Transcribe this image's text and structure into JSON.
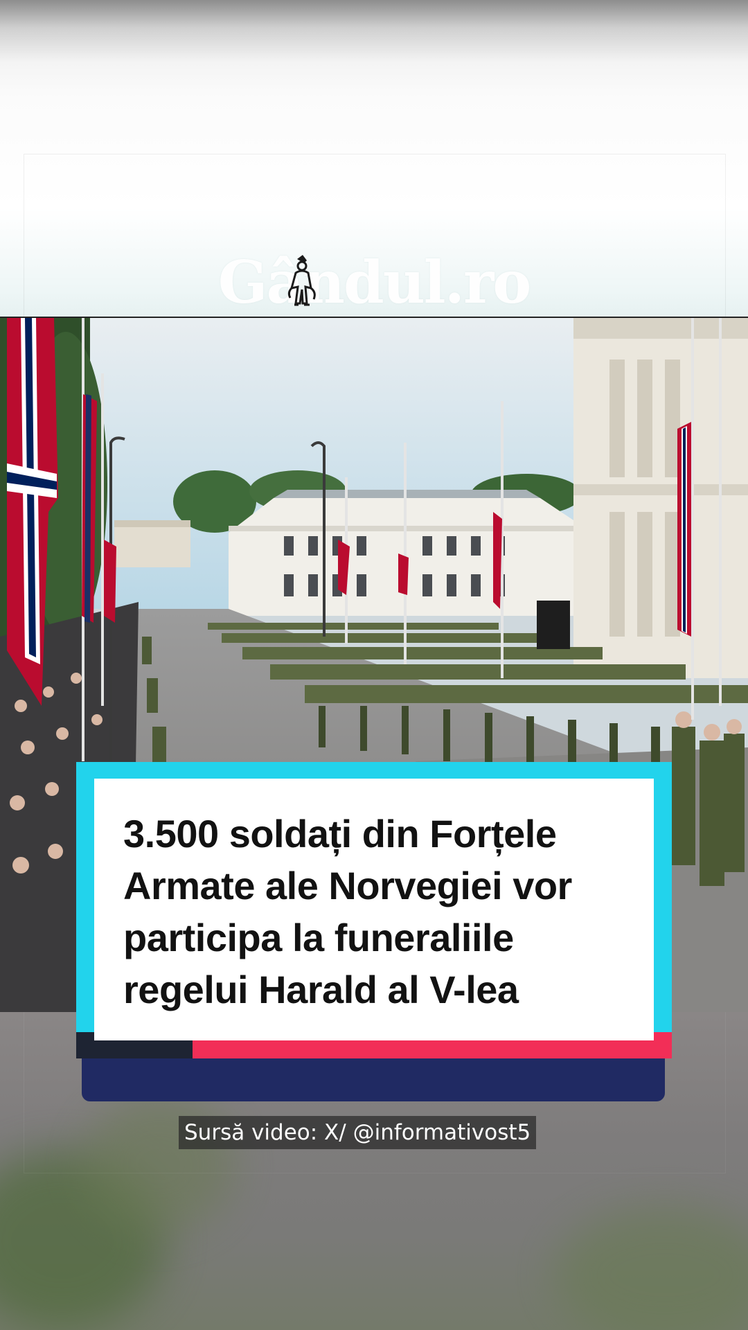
{
  "brand": {
    "logo_text": "Gândul.ro"
  },
  "headline": {
    "text": "3.500 soldați din Forțele Armate ale Norvegiei vor participa la funeraliile regelui Harald al V-lea"
  },
  "caption": {
    "source": "Sursă video: X/ @informativost5"
  },
  "colors": {
    "card_cyan": "#22d3ec",
    "card_red": "#f22e57",
    "card_navy": "#202a63",
    "card_dark": "#1e2433",
    "norway_red": "#ba0c2f",
    "norway_blue": "#00205b"
  },
  "icons": {
    "logo_mascot": "jester-figure-icon"
  }
}
